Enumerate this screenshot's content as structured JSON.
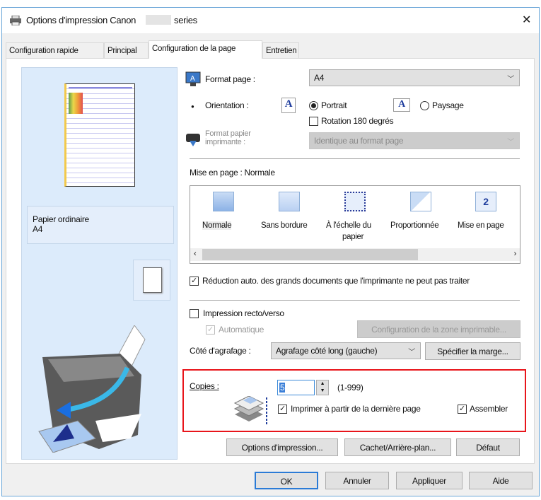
{
  "window": {
    "title": "Options d'impression Canon",
    "title_suffix": "series",
    "close": "✕"
  },
  "tabs": [
    {
      "label": "Configuration rapide"
    },
    {
      "label": "Principal"
    },
    {
      "label": "Configuration de la page",
      "selected": true
    },
    {
      "label": "Entretien"
    }
  ],
  "preview": {
    "paper_type": "Papier ordinaire",
    "paper_size": "A4"
  },
  "page_size": {
    "label": "Format page :",
    "value": "A4"
  },
  "orientation": {
    "label": "Orientation :",
    "portrait": "Portrait",
    "landscape": "Paysage",
    "selected": "Portrait",
    "rotate_label": "Rotation 180 degrés",
    "rotate_checked": false
  },
  "printer_paper": {
    "label_line1": "Format papier",
    "label_line2": "imprimante :",
    "value": "Identique au format page"
  },
  "layout": {
    "label": "Mise en page : Normale",
    "items": [
      {
        "label": "Normale"
      },
      {
        "label": "Sans bordure"
      },
      {
        "label": "À l'échelle du",
        "label2": "papier"
      },
      {
        "label": "Proportionnée"
      },
      {
        "label": "Mise en page",
        "icon_text": "2"
      }
    ],
    "scroll_fraction": 0.65
  },
  "auto_reduce": {
    "label": "Réduction auto. des grands documents que l'imprimante ne peut pas traiter",
    "checked": true
  },
  "duplex": {
    "label": "Impression recto/verso",
    "checked": false,
    "auto_label": "Automatique",
    "auto_checked": true,
    "area_button": "Configuration de la zone imprimable..."
  },
  "stapling": {
    "label": "Côté d'agrafage :",
    "value": "Agrafage côté long (gauche)",
    "margin_button": "Spécifier la marge..."
  },
  "copies": {
    "label": "Copies :",
    "value": "5",
    "range": "(1-999)",
    "reverse_label": "Imprimer à partir de la dernière page",
    "reverse_checked": true,
    "collate_label": "Assembler",
    "collate_checked": true,
    "highlight_color": "#e8151b"
  },
  "actions": {
    "print_options": "Options d'impression...",
    "stamp": "Cachet/Arrière-plan...",
    "defaults": "Défaut"
  },
  "footer": {
    "ok": "OK",
    "cancel": "Annuler",
    "apply": "Appliquer",
    "help": "Aide"
  }
}
